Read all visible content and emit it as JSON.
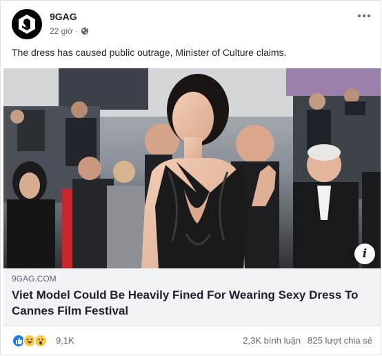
{
  "post": {
    "page_name": "9GAG",
    "time": "22 giờ",
    "separator": "·",
    "privacy_icon": "globe-icon",
    "more_icon": "ellipsis-icon",
    "text": "The dress has caused public outrage, Minister of Culture claims.",
    "photo_icon": "info-icon",
    "photo_info_glyph": "i"
  },
  "link": {
    "domain": "9GAG.COM",
    "title": "Viet Model Could Be Heavily Fined For Wearing Sexy Dress To Cannes Film Festival"
  },
  "footer": {
    "reaction_icons": [
      "like-icon",
      "haha-icon",
      "wow-icon"
    ],
    "reaction_count": "9,1K",
    "comments": "2,3K bình luận",
    "shares": "825 lượt chia sẻ"
  },
  "colors": {
    "like_blue": "#1877f2",
    "emoji_yellow": "#f7c94b",
    "dress_black": "#1a1a1a"
  }
}
